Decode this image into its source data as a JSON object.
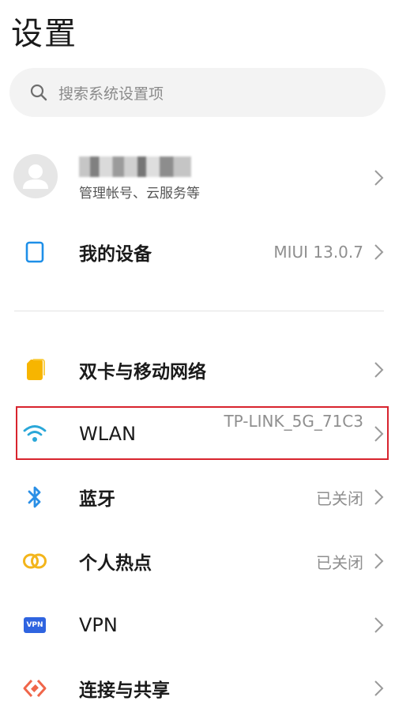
{
  "page": {
    "title": "设置"
  },
  "search": {
    "placeholder": "搜索系统设置项"
  },
  "account": {
    "subtitle": "管理帐号、云服务等"
  },
  "items": [
    {
      "id": "my-device",
      "label": "我的设备",
      "value": "MIUI 13.0.7",
      "icon": "device-icon",
      "color": "#1e8fe8"
    },
    {
      "id": "sim",
      "label": "双卡与移动网络",
      "value": "",
      "icon": "sim-card-icon",
      "color": "#f7b500"
    },
    {
      "id": "wlan",
      "label": "WLAN",
      "value": "TP-LINK_5G_71C3",
      "icon": "wifi-icon",
      "color": "#2aa7d8"
    },
    {
      "id": "bluetooth",
      "label": "蓝牙",
      "value": "已关闭",
      "icon": "bluetooth-icon",
      "color": "#2a8fe6"
    },
    {
      "id": "hotspot",
      "label": "个人热点",
      "value": "已关闭",
      "icon": "hotspot-icon",
      "color": "#f3b51b"
    },
    {
      "id": "vpn",
      "label": "VPN",
      "value": "",
      "icon": "vpn-icon",
      "icon_text": "VPN",
      "color": "#2f64e0"
    },
    {
      "id": "connect-share",
      "label": "连接与共享",
      "value": "",
      "icon": "connect-share-icon",
      "color": "#f0664a"
    }
  ],
  "colors": {
    "highlight": "#d8242e",
    "value_text": "#8f8f8f"
  }
}
